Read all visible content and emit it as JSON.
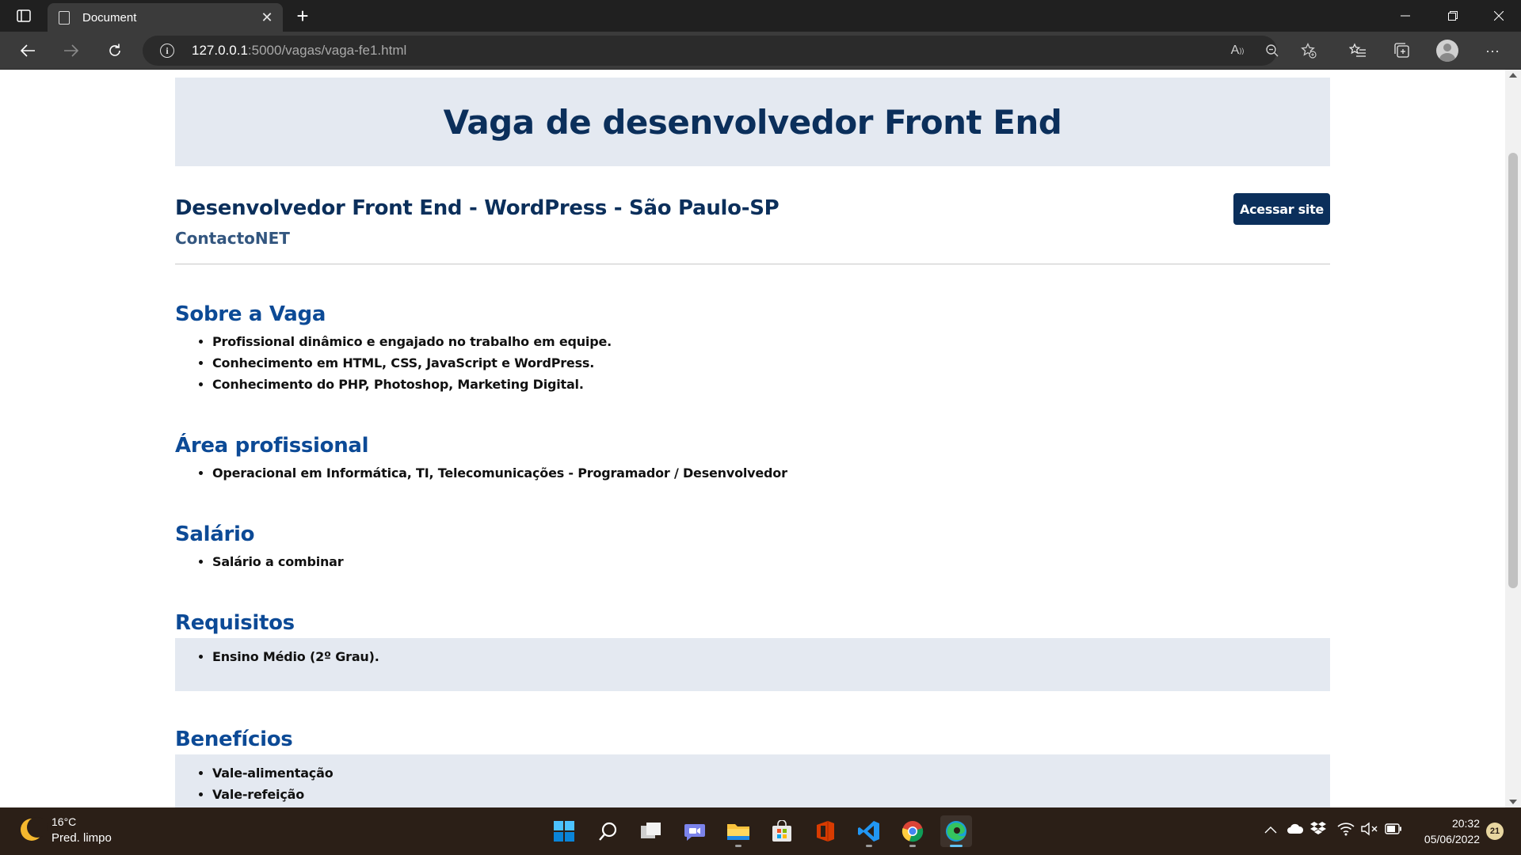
{
  "browser": {
    "tab_title": "Document",
    "url_host": "127.0.0.1",
    "url_path": ":5000/vagas/vaga-fe1.html"
  },
  "page": {
    "hero_title": "Vaga de desenvolvedor Front End",
    "job_title": "Desenvolvedor Front End - WordPress - São Paulo-SP",
    "company": "ContactoNET",
    "site_button_label": "Acessar site",
    "sections": [
      {
        "title": "Sobre a Vaga",
        "items": [
          "Profissional dinâmico e engajado no trabalho em equipe.",
          "Conhecimento em HTML, CSS, JavaScript e WordPress.",
          "Conhecimento do PHP, Photoshop, Marketing Digital."
        ]
      },
      {
        "title": "Área profissional",
        "items": [
          "Operacional em Informática, TI, Telecomunicações - Programador / Desenvolvedor"
        ]
      },
      {
        "title": "Salário",
        "items": [
          "Salário a combinar"
        ]
      },
      {
        "title": "Requisitos",
        "items": [
          "Ensino Médio (2º Grau)."
        ]
      },
      {
        "title": "Benefícios",
        "items": [
          "Vale-alimentação",
          "Vale-refeição"
        ]
      }
    ]
  },
  "taskbar": {
    "weather_temp": "16°C",
    "weather_desc": "Pred. limpo",
    "time": "20:32",
    "date": "05/06/2022",
    "notification_count": "21"
  },
  "colors": {
    "heading_dark": "#0b2f5b",
    "heading_blue": "#0c4a96",
    "hero_bg": "#e4e9f1",
    "button_bg": "#0b2f5b"
  }
}
